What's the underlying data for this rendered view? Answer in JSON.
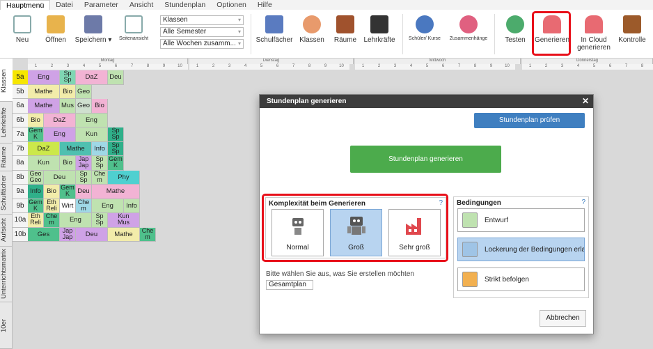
{
  "menu": [
    "Hauptmenü",
    "Datei",
    "Parameter",
    "Ansicht",
    "Stundenplan",
    "Optionen",
    "Hilfe"
  ],
  "ribbon": {
    "neu": "Neu",
    "oeffnen": "Öffnen",
    "speichern": "Speichern",
    "seitenansicht": "Seitenansicht",
    "combo1": "Klassen",
    "combo2": "Alle Semester",
    "combo3": "Alle Wochen zusamm...",
    "schulfaecher": "Schulfächer",
    "klassen": "Klassen",
    "raeume": "Räume",
    "lehrkraefte": "Lehrkräfte",
    "schueler": "Schüler/ Kurse",
    "zusammen": "Zusammenhänge",
    "testen": "Testen",
    "generieren": "Generieren",
    "cloud": "In Cloud generieren",
    "kontrolle": "Kontrolle"
  },
  "sidetabs": [
    "Klassen",
    "Lehrkräfte",
    "Räume",
    "Schulfächer",
    "Aufsicht",
    "Unterrichtsmatrix",
    "10er"
  ],
  "days": [
    "Montag",
    "Dienstag",
    "Mittwoch",
    "Donnerstag"
  ],
  "periods": [
    "1",
    "2",
    "3",
    "4",
    "5",
    "6",
    "7",
    "8",
    "9",
    "10"
  ],
  "classes": [
    "5a",
    "5b",
    "6a",
    "6b",
    "7a",
    "7b",
    "8a",
    "8b",
    "9a",
    "9b",
    "10a",
    "10b"
  ],
  "grid": {
    "monday": [
      [
        [
          "Eng",
          2,
          "#cfa2e6"
        ],
        [
          "Sp Sp",
          1,
          "#7fd6b3"
        ],
        [
          "DaZ",
          2,
          "#f2b3d4"
        ],
        [
          "Deu",
          1,
          "#bfe2b0"
        ]
      ],
      [
        [
          "Mathe",
          2,
          "#f2ecaa"
        ],
        [
          "Bio",
          1,
          "#f2ecaa"
        ],
        [
          "Geo",
          1,
          "#bfe2b0"
        ]
      ],
      [
        [
          "Mathe",
          2,
          "#cfa2e6"
        ],
        [
          "Mus",
          1,
          "#bfe2b0"
        ],
        [
          "Geo",
          1,
          "#cfe0cf"
        ],
        [
          "Bio",
          1,
          "#f2b3d4"
        ]
      ],
      [
        [
          "Bio",
          1,
          "#f2ecaa"
        ],
        [
          "DaZ",
          2,
          "#f2b3d4"
        ],
        [
          "Eng",
          2,
          "#bfe2b0"
        ]
      ],
      [
        [
          "Gem K",
          1,
          "#4fc08c"
        ],
        [
          "Eng",
          2,
          "#cfa2e6"
        ],
        [
          "Kun",
          2,
          "#bfe2b0"
        ],
        [
          "Sp Sp",
          1,
          "#2fb08a"
        ]
      ],
      [
        [
          "DaZ",
          2,
          "#cce84a"
        ],
        [
          "Mathe",
          2,
          "#4fc0b0"
        ],
        [
          "Info",
          1,
          "#9fd8e6"
        ],
        [
          "Sp Sp",
          1,
          "#2fb08a"
        ]
      ],
      [
        [
          "Kun",
          2,
          "#bfe2b0"
        ],
        [
          "Bio",
          1,
          "#bfe2b0"
        ],
        [
          "Jap Jap",
          1,
          "#cfa2e6"
        ],
        [
          "Sp Sp",
          1,
          "#bfe2b0"
        ],
        [
          "Gem K",
          1,
          "#4fc08c"
        ]
      ],
      [
        [
          "Geo Geo",
          1,
          "#bfe2b0"
        ],
        [
          "Deu",
          2,
          "#bfe2b0"
        ],
        [
          "Sp Sp",
          1,
          "#bfe2b0"
        ],
        [
          "Che m",
          1,
          "#bfe2b0"
        ],
        [
          "Phy",
          2,
          "#4fd0d0"
        ]
      ],
      [
        [
          "Info",
          1,
          "#2fb08a"
        ],
        [
          "Bio",
          1,
          "#f2ecaa"
        ],
        [
          "Gem K",
          1,
          "#4fc08c"
        ],
        [
          "Deu",
          1,
          "#f2b3d4"
        ],
        [
          "Mathe",
          3,
          "#f2b3d4"
        ]
      ],
      [
        [
          "Gem K",
          1,
          "#4fc08c"
        ],
        [
          "Eth Reli",
          1,
          "#f2ecaa"
        ],
        [
          "Wirt",
          1,
          "#fff"
        ],
        [
          "Che m",
          1,
          "#9fd8e6"
        ],
        [
          "Eng",
          2,
          "#bfe2b0"
        ],
        [
          "Info",
          1,
          "#bfe2b0"
        ]
      ],
      [
        [
          "Eth Reli",
          1,
          "#f2ecaa"
        ],
        [
          "Che m",
          1,
          "#4fc08c"
        ],
        [
          "Eng",
          2,
          "#bfe2b0"
        ],
        [
          "Sp Sp",
          1,
          "#bfe2b0"
        ],
        [
          "Kun Mus",
          2,
          "#cfa2e6"
        ]
      ],
      [
        [
          "Ges",
          2,
          "#4fc08c"
        ],
        [
          "Jap Jap",
          1,
          "#cfa2e6"
        ],
        [
          "Deu",
          2,
          "#cfa2e6"
        ],
        [
          "Mathe",
          2,
          "#f2ecaa"
        ],
        [
          "Che m",
          1,
          "#4fc08c"
        ]
      ]
    ]
  },
  "modal": {
    "title": "Stundenplan generieren",
    "close": "✕",
    "pruefen": "Stundenplan prüfen",
    "generieren": "Stundenplan generieren",
    "komplex_title": "Komplexität beim Generieren",
    "help": "?",
    "normal": "Normal",
    "gross": "Groß",
    "sehrgross": "Sehr groß",
    "bed_title": "Bedingungen",
    "entwurf": "Entwurf",
    "lockerung": "Lockerung der Bedingungen erlau",
    "strikt": "Strikt befolgen",
    "choose": "Bitte wählen Sie aus, was Sie erstellen möchten",
    "gesamt": "Gesamtplan",
    "abbrechen": "Abbrechen"
  }
}
